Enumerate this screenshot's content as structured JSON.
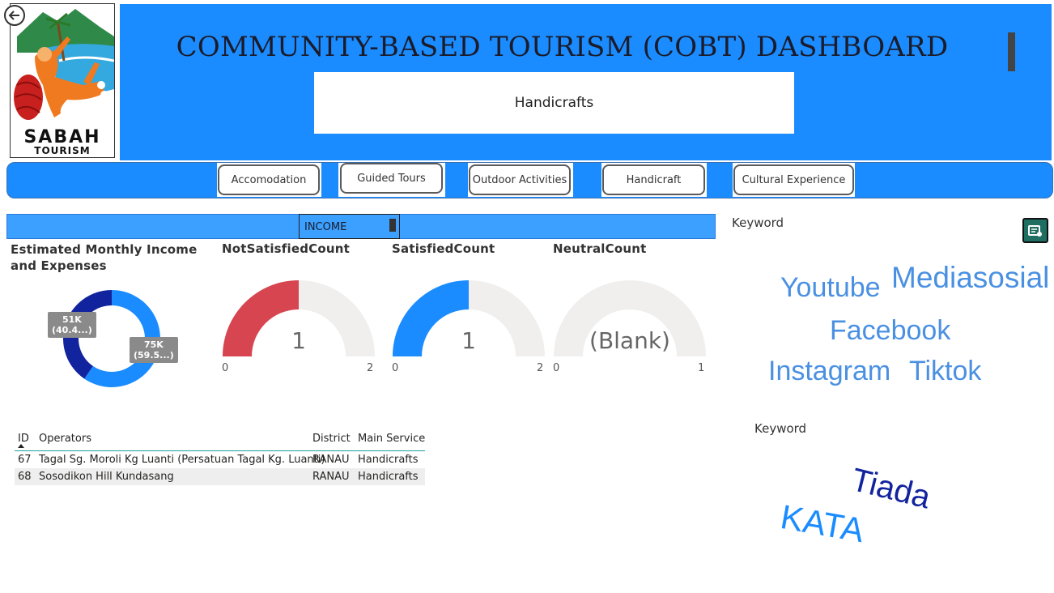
{
  "logo": {
    "brand_line1": "SABAH",
    "brand_line2": "TOURISM"
  },
  "header": {
    "title": "COMMUNITY-BASED TOURISM (COBT) DASHBOARD",
    "category": "Handicrafts"
  },
  "nav": {
    "buttons": [
      "Accomodation",
      "Guided Tours",
      "Outdoor Activities",
      "Handicraft",
      "Cultural Experience"
    ]
  },
  "filter": {
    "label": "INCOME"
  },
  "donut": {
    "title": "Estimated Monthly Income and Expenses",
    "slices": [
      {
        "value_label": "75K",
        "pct_label": "(59.5...)",
        "value": 75,
        "pct": 59.5,
        "color": "#1a8cff"
      },
      {
        "value_label": "51K",
        "pct_label": "(40.4...)",
        "value": 51,
        "pct": 40.4,
        "color": "#12239e"
      }
    ]
  },
  "gauges": [
    {
      "title": "NotSatisfiedCount",
      "value_text": "1",
      "value": 1,
      "min": "0",
      "max": "2",
      "color": "#d64550"
    },
    {
      "title": "SatisfiedCount",
      "value_text": "1",
      "value": 1,
      "min": "0",
      "max": "2",
      "color": "#1a8cff"
    },
    {
      "title": "NeutralCount",
      "value_text": "(Blank)",
      "value": 0,
      "min": "0",
      "max": "1",
      "color": "#1a8cff"
    }
  ],
  "table": {
    "columns": [
      "ID",
      "Operators",
      "District",
      "Main Service"
    ],
    "rows": [
      [
        "67",
        "Tagal Sg. Moroli Kg Luanti (Persatuan Tagal Kg. Luanti)",
        "RANAU",
        "Handicrafts"
      ],
      [
        "68",
        "Sosodikon Hill Kundasang",
        "RANAU",
        "Handicrafts"
      ]
    ]
  },
  "keywords1": {
    "title": "Keyword",
    "words": [
      "Youtube",
      "Mediasosial",
      "Facebook",
      "Instagram",
      "Tiktok"
    ]
  },
  "keywords2": {
    "title": "Keyword",
    "words": [
      "Tiada",
      "KATA"
    ]
  },
  "colors": {
    "accent": "#1a8cff",
    "header_band": "#1a8cff",
    "filter_band": "#3ba0ff",
    "negative": "#d64550",
    "dark_blue": "#12239e"
  },
  "icons": {
    "back": "back-arrow-icon",
    "export": "export-icon"
  }
}
